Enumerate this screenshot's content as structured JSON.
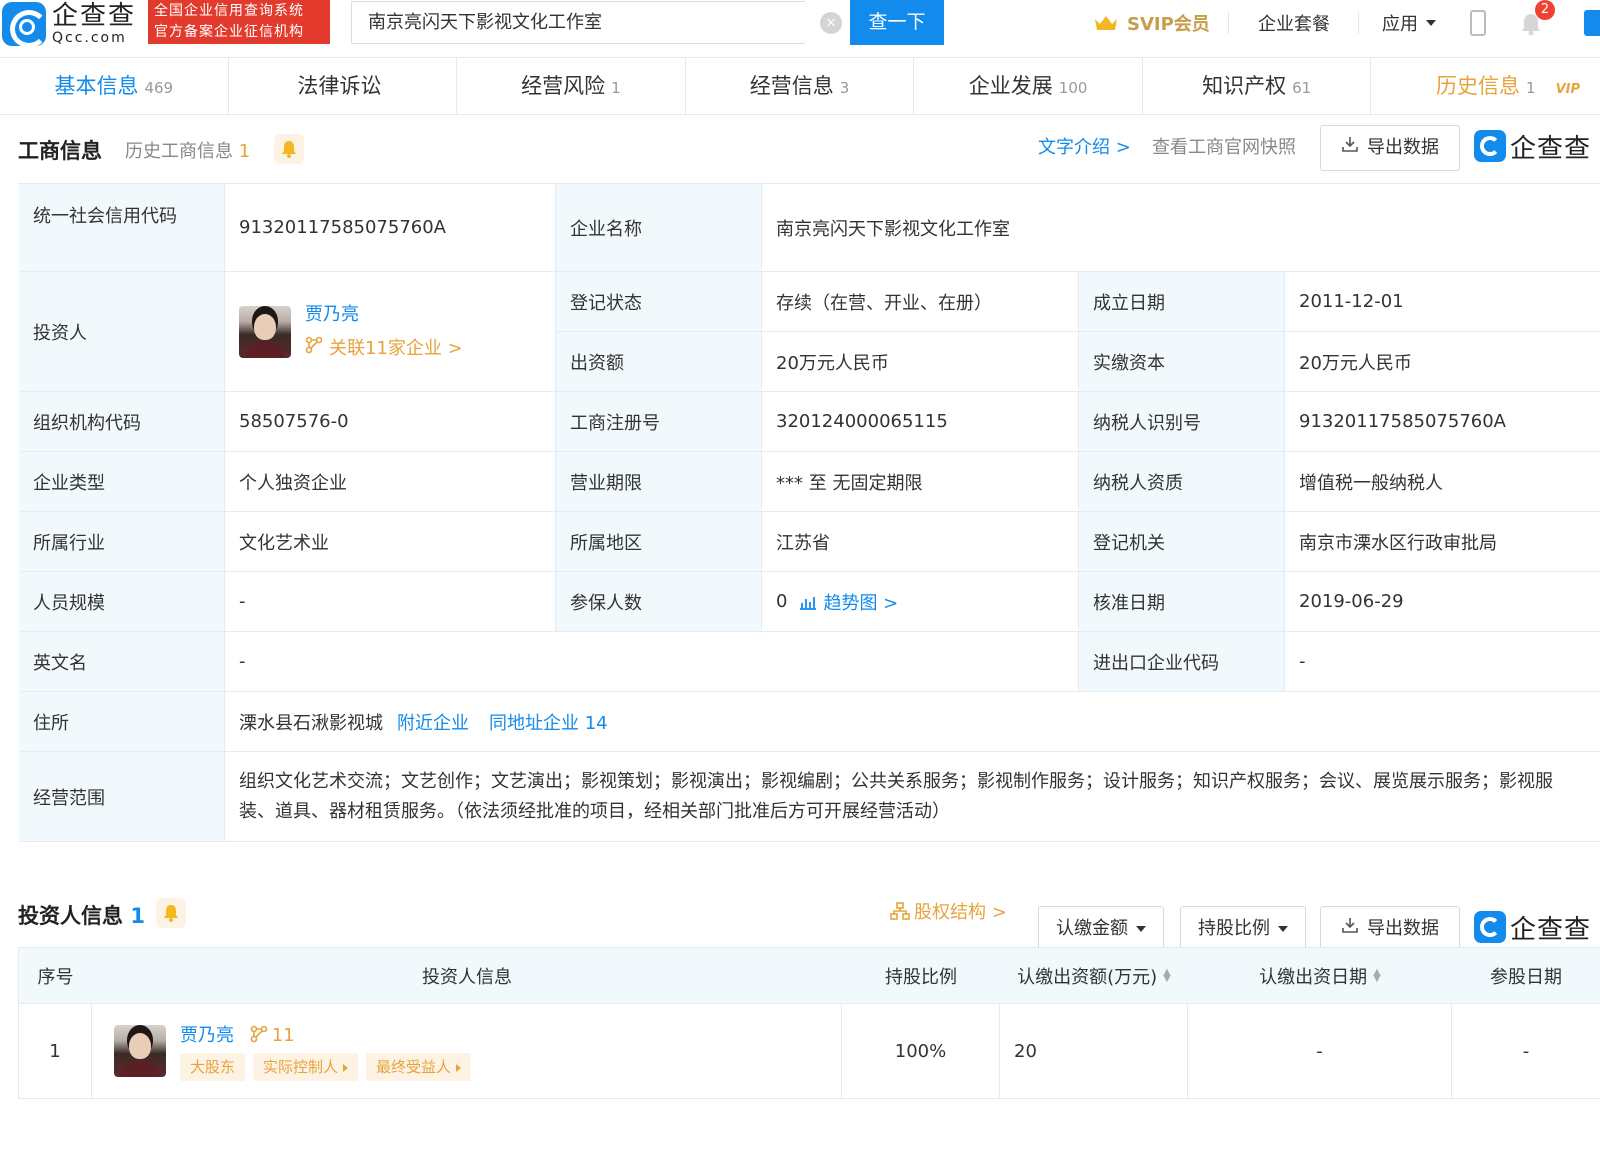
{
  "header": {
    "logo_cn": "企查查",
    "logo_en": "Qcc.com",
    "badge_line1": "全国企业信用查询系统",
    "badge_line2": "官方备案企业征信机构",
    "search_value": "南京亮闪天下影视文化工作室",
    "search_button": "查一下",
    "svip": "SVIP会员",
    "package": "企业套餐",
    "app": "应用",
    "notification_count": "2",
    "crown_icon": "crown-icon",
    "brand_color": "#128bed"
  },
  "tabs": [
    {
      "label": "基本信息",
      "count": "469"
    },
    {
      "label": "法律诉讼",
      "count": ""
    },
    {
      "label": "经营风险",
      "count": "1"
    },
    {
      "label": "经营信息",
      "count": "3"
    },
    {
      "label": "企业发展",
      "count": "100"
    },
    {
      "label": "知识产权",
      "count": "61"
    },
    {
      "label": "历史信息",
      "count": "1",
      "badge": "VIP"
    }
  ],
  "business": {
    "title": "工商信息",
    "history_label": "历史工商信息",
    "history_count": "1",
    "intro_link": "文字介绍 >",
    "snapshot_link": "查看工商官网快照",
    "export": "导出数据",
    "watermark": "企查查",
    "rows": {
      "credit_code_label": "统一社会信用代码",
      "credit_code": "91320117585075760A",
      "company_name_label": "企业名称",
      "company_name": "南京亮闪天下影视文化工作室",
      "investor_label": "投资人",
      "investor_name": "贾乃亮",
      "investor_related": "关联11家企业 >",
      "status_label": "登记状态",
      "status": "存续（在营、开业、在册）",
      "found_date_label": "成立日期",
      "found_date": "2011-12-01",
      "capital_label": "出资额",
      "capital": "20万元人民币",
      "paid_capital_label": "实缴资本",
      "paid_capital": "20万元人民币",
      "org_code_label": "组织机构代码",
      "org_code": "58507576-0",
      "reg_no_label": "工商注册号",
      "reg_no": "320124000065115",
      "tax_id_label": "纳税人识别号",
      "tax_id": "91320117585075760A",
      "type_label": "企业类型",
      "type": "个人独资企业",
      "term_label": "营业期限",
      "term": "*** 至 无固定期限",
      "tax_quality_label": "纳税人资质",
      "tax_quality": "增值税一般纳税人",
      "industry_label": "所属行业",
      "industry": "文化艺术业",
      "region_label": "所属地区",
      "region": "江苏省",
      "authority_label": "登记机关",
      "authority": "南京市溧水区行政审批局",
      "staff_label": "人员规模",
      "staff": "-",
      "insured_label": "参保人数",
      "insured": "0",
      "trend_link": "趋势图 >",
      "approve_date_label": "核准日期",
      "approve_date": "2019-06-29",
      "english_name_label": "英文名",
      "english_name": "-",
      "import_export_label": "进出口企业代码",
      "import_export": "-",
      "address_label": "住所",
      "address": "溧水县石湫影视城",
      "nearby_link": "附近企业",
      "same_address_link": "同地址企业 14",
      "scope_label": "经营范围",
      "scope": "组织文化艺术交流；文艺创作；文艺演出；影视策划；影视演出；影视编剧；公共关系服务；影视制作服务；设计服务；知识产权服务；会议、展览展示服务；影视服装、道具、器材租赁服务。（依法须经批准的项目，经相关部门批准后方可开展经营活动）"
    }
  },
  "investors": {
    "title": "投资人信息",
    "count": "1",
    "equity_link": "股权结构 >",
    "filter_amount": "认缴金额",
    "filter_ratio": "持股比例",
    "export": "导出数据",
    "watermark": "企查查",
    "columns": [
      "序号",
      "投资人信息",
      "持股比例",
      "认缴出资额(万元)",
      "认缴出资日期",
      "参股日期"
    ],
    "rows": [
      {
        "index": "1",
        "name": "贾乃亮",
        "related_count": "11",
        "tags": [
          "大股东",
          "实际控制人",
          "最终受益人"
        ],
        "ratio": "100%",
        "amount": "20",
        "date": "-",
        "join_date": "-"
      }
    ]
  }
}
